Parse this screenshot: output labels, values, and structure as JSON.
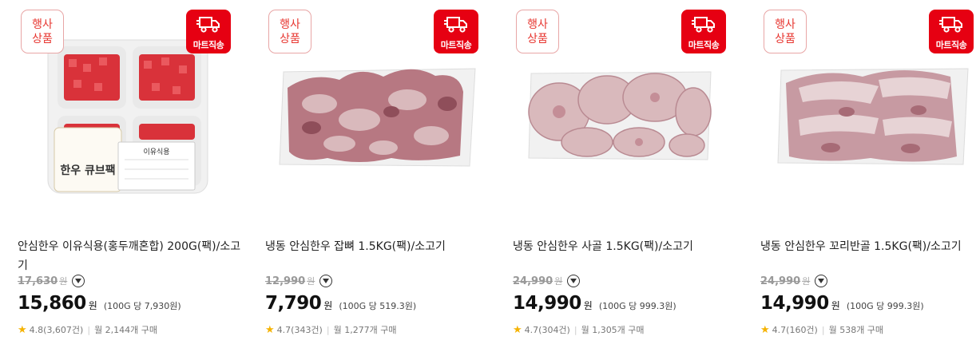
{
  "products": [
    {
      "badge_promo": "행사\n상품",
      "badge_promo_line1": "행사",
      "badge_promo_line2": "상품",
      "badge_delivery": "마트직송",
      "name": "안심한우 이유식용(홍두깨혼합) 200G(팩)/소고기",
      "original_price": "17,630",
      "original_unit": "원",
      "price": "15,860",
      "price_unit": "원",
      "unit_price": "(100G 당 7,930원)",
      "rating": "4.8(3,607건)",
      "monthly_sales": "월 2,144개 구매",
      "image_text_1": "한우 큐브팩",
      "image_text_2": "이유식용"
    },
    {
      "badge_promo_line1": "행사",
      "badge_promo_line2": "상품",
      "badge_delivery": "마트직송",
      "name": "냉동 안심한우 잡뼈 1.5KG(팩)/소고기",
      "original_price": "12,990",
      "original_unit": "원",
      "price": "7,790",
      "price_unit": "원",
      "unit_price": "(100G 당 519.3원)",
      "rating": "4.7(343건)",
      "monthly_sales": "월 1,277개 구매"
    },
    {
      "badge_promo_line1": "행사",
      "badge_promo_line2": "상품",
      "badge_delivery": "마트직송",
      "name": "냉동 안심한우 사골 1.5KG(팩)/소고기",
      "original_price": "24,990",
      "original_unit": "원",
      "price": "14,990",
      "price_unit": "원",
      "unit_price": "(100G 당 999.3원)",
      "rating": "4.7(304건)",
      "monthly_sales": "월 1,305개 구매"
    },
    {
      "badge_promo_line1": "행사",
      "badge_promo_line2": "상품",
      "badge_delivery": "마트직송",
      "name": "냉동 안심한우 꼬리반골 1.5KG(팩)/소고기",
      "original_price": "24,990",
      "original_unit": "원",
      "price": "14,990",
      "price_unit": "원",
      "unit_price": "(100G 당 999.3원)",
      "rating": "4.7(160건)",
      "monthly_sales": "월 538개 구매"
    }
  ],
  "icons": {
    "delivery": "truck-icon",
    "info": "chevron-down-circle-icon",
    "rating": "star-icon"
  },
  "colors": {
    "promo_badge": "#e7352f",
    "delivery_badge": "#e60012",
    "star": "#f5b301"
  }
}
